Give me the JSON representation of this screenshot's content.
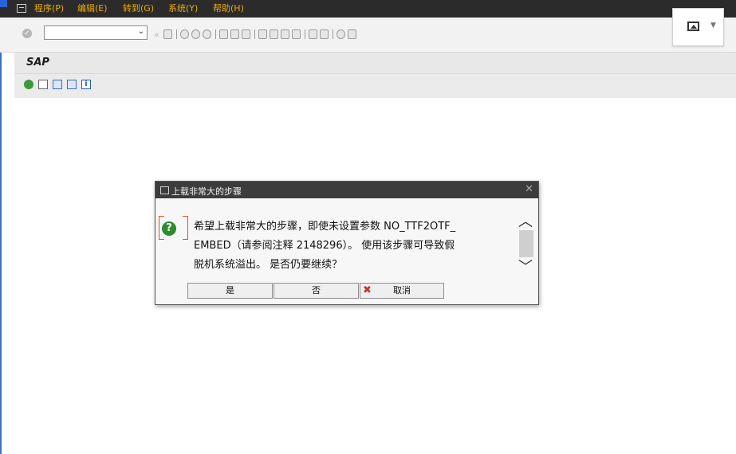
{
  "menubar": {
    "items": [
      "程序(P)",
      "编辑(E)",
      "转到(G)",
      "系统(Y)",
      "帮助(H)"
    ]
  },
  "toolbar": {
    "command_field_value": "",
    "image_button_icon": "image-icon"
  },
  "screen": {
    "title": "SAP"
  },
  "dialog": {
    "title": "上载非常大的步骤",
    "message_lines": [
      "希望上载非常大的步骤，即使未设置参数 NO_TTF2OTF_",
      "EMBED（请参阅注释 2148296）。 使用该步骤可导致假",
      "脱机系统溢出。 是否仍要继续？"
    ],
    "buttons": {
      "yes": "是",
      "no": "否",
      "cancel": "取消"
    }
  },
  "colors": {
    "menu_text": "#f0ab00",
    "menu_bg": "#2b2b2b",
    "dialog_title_bg": "#3c3c3c",
    "question_icon": "#2e8b2e"
  }
}
